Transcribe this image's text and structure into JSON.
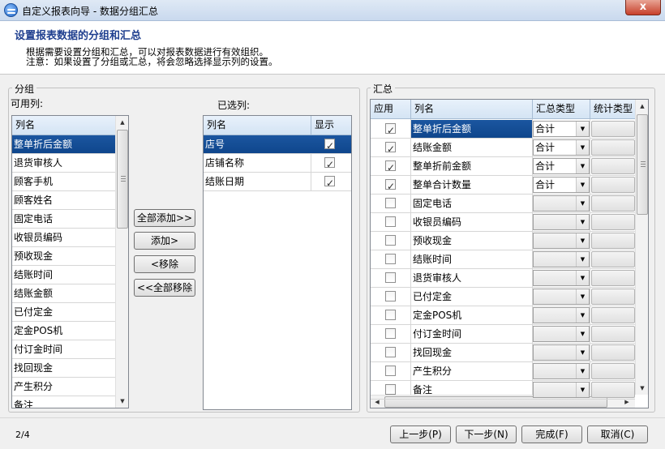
{
  "window": {
    "title": "自定义报表向导 - 数据分组汇总",
    "close_label": "x"
  },
  "header": {
    "title": "设置报表数据的分组和汇总",
    "line1": "根据需要设置分组和汇总，可以对报表数据进行有效组织。",
    "line2": "注意：如果设置了分组或汇总，将会忽略选择显示列的设置。"
  },
  "group": {
    "legend": "分组",
    "available_label": "可用列:",
    "selected_label": "已选列:",
    "available_header": "列名",
    "available": [
      "整单折后金额",
      "退货审核人",
      "顾客手机",
      "顾客姓名",
      "固定电话",
      "收银员编码",
      "预收现金",
      "结账时间",
      "结账金额",
      "已付定金",
      "定金POS机",
      "付订金时间",
      "找回现金",
      "产生积分",
      "备注"
    ],
    "selected_headers": {
      "name": "列名",
      "show": "显示"
    },
    "selected": [
      {
        "name": "店号",
        "show": true
      },
      {
        "name": "店铺名称",
        "show": true
      },
      {
        "name": "结账日期",
        "show": true
      }
    ],
    "buttons": {
      "add_all": "全部添加>>",
      "add": "添加>",
      "remove": "<移除",
      "remove_all": "<<全部移除"
    }
  },
  "summary": {
    "legend": "汇总",
    "headers": {
      "apply": "应用",
      "name": "列名",
      "agg": "汇总类型",
      "stat": "统计类型"
    },
    "rows": [
      {
        "checked": true,
        "name": "整单折后金额",
        "agg": "合计"
      },
      {
        "checked": true,
        "name": "结账金额",
        "agg": "合计"
      },
      {
        "checked": true,
        "name": "整单折前金额",
        "agg": "合计"
      },
      {
        "checked": true,
        "name": "整单合计数量",
        "agg": "合计"
      },
      {
        "checked": false,
        "name": "固定电话",
        "agg": ""
      },
      {
        "checked": false,
        "name": "收银员编码",
        "agg": ""
      },
      {
        "checked": false,
        "name": "预收现金",
        "agg": ""
      },
      {
        "checked": false,
        "name": "结账时间",
        "agg": ""
      },
      {
        "checked": false,
        "name": "退货审核人",
        "agg": ""
      },
      {
        "checked": false,
        "name": "已付定金",
        "agg": ""
      },
      {
        "checked": false,
        "name": "定金POS机",
        "agg": ""
      },
      {
        "checked": false,
        "name": "付订金时间",
        "agg": ""
      },
      {
        "checked": false,
        "name": "找回现金",
        "agg": ""
      },
      {
        "checked": false,
        "name": "产生积分",
        "agg": ""
      },
      {
        "checked": false,
        "name": "备注",
        "agg": ""
      }
    ]
  },
  "footer": {
    "page": "2/4",
    "prev": "上一步(P)",
    "next": "下一步(N)",
    "finish": "完成(F)",
    "cancel": "取消(C)"
  },
  "icons": [
    "app-icon",
    "close-icon",
    "scroll-up-arrow-icon",
    "scroll-down-arrow-icon",
    "scroll-left-arrow-icon",
    "scroll-right-arrow-icon",
    "dropdown-arrow-icon"
  ]
}
